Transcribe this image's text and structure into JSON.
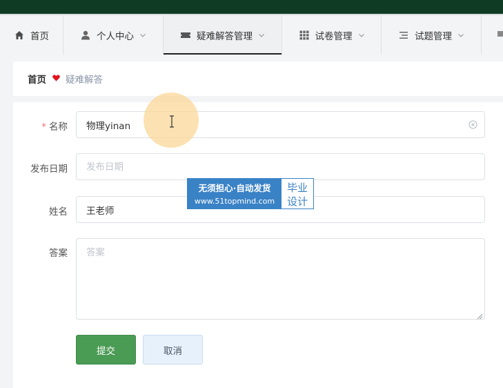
{
  "nav": {
    "items": [
      {
        "label": "首页",
        "icon": "home-icon"
      },
      {
        "label": "个人中心",
        "icon": "user-icon"
      },
      {
        "label": "疑难解答管理",
        "icon": "ticket-icon"
      },
      {
        "label": "试卷管理",
        "icon": "grid-icon"
      },
      {
        "label": "试题管理",
        "icon": "list-icon"
      }
    ]
  },
  "breadcrumb": {
    "home": "首页",
    "current": "疑难解答"
  },
  "form": {
    "name": {
      "label": "名称",
      "required_mark": "*",
      "value": "物理yinan"
    },
    "date": {
      "label": "发布日期",
      "placeholder": "发布日期"
    },
    "person": {
      "label": "姓名",
      "value": "王老师"
    },
    "answer": {
      "label": "答案",
      "placeholder": "答案"
    }
  },
  "buttons": {
    "submit": "提交",
    "cancel": "取消"
  },
  "watermark": {
    "line1": "无须担心·自动发货",
    "line2": "www.51topmind.com",
    "side1": "毕业",
    "side2": "设计"
  },
  "colors": {
    "topbar": "#0f3b24",
    "submit": "#4a9b54",
    "cancel": "#e7f1fb",
    "heart": "#e0141e",
    "watermark": "#3a82c6"
  }
}
